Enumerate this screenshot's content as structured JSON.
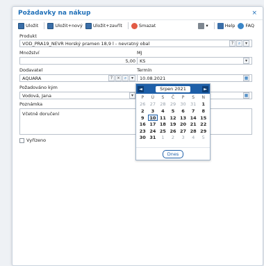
{
  "dialog": {
    "title": "Požadavky na nákup",
    "close_glyph": "×"
  },
  "toolbar": {
    "save": "Uložit",
    "save_new": "Uložit+nový",
    "save_close": "Uložit+zavřít",
    "delete": "Smazat",
    "help": "Help",
    "faq": "FAQ"
  },
  "form": {
    "product_label": "Produkt",
    "product_value": "VOD_PRA19_NEVR Horský pramen 18,9 l - nevratný obal",
    "quantity_label": "Množství",
    "quantity_value": "5,00",
    "unit_label": "MJ",
    "unit_value": "KS",
    "supplier_label": "Dodavatel",
    "supplier_value": "AQUARA",
    "term_label": "Termín",
    "term_value": "10.08.2021",
    "requested_by_label": "Požadováno kým",
    "requested_by_value": "Vodová, Jana",
    "note_label": "Poznámka",
    "note_value": "Včetně doručení",
    "done_label": "Vyřízeno"
  },
  "calendar": {
    "month": "Srpen 2021",
    "prev": "◄",
    "next": "►",
    "weekdays": [
      "P",
      "Ú",
      "S",
      "Č",
      "P",
      "S",
      "N"
    ],
    "days": [
      {
        "d": "26",
        "o": true
      },
      {
        "d": "27",
        "o": true
      },
      {
        "d": "28",
        "o": true
      },
      {
        "d": "29",
        "o": true
      },
      {
        "d": "30",
        "o": true
      },
      {
        "d": "31",
        "o": true
      },
      {
        "d": "1",
        "o": false
      },
      {
        "d": "2",
        "o": false
      },
      {
        "d": "3",
        "o": false
      },
      {
        "d": "4",
        "o": false
      },
      {
        "d": "5",
        "o": false
      },
      {
        "d": "6",
        "o": false
      },
      {
        "d": "7",
        "o": false
      },
      {
        "d": "8",
        "o": false
      },
      {
        "d": "9",
        "o": false
      },
      {
        "d": "10",
        "o": false,
        "sel": true
      },
      {
        "d": "11",
        "o": false
      },
      {
        "d": "12",
        "o": false
      },
      {
        "d": "13",
        "o": false
      },
      {
        "d": "14",
        "o": false
      },
      {
        "d": "15",
        "o": false
      },
      {
        "d": "16",
        "o": false
      },
      {
        "d": "17",
        "o": false
      },
      {
        "d": "18",
        "o": false
      },
      {
        "d": "19",
        "o": false
      },
      {
        "d": "20",
        "o": false
      },
      {
        "d": "21",
        "o": false
      },
      {
        "d": "22",
        "o": false
      },
      {
        "d": "23",
        "o": false
      },
      {
        "d": "24",
        "o": false
      },
      {
        "d": "25",
        "o": false
      },
      {
        "d": "26",
        "o": false
      },
      {
        "d": "27",
        "o": false
      },
      {
        "d": "28",
        "o": false
      },
      {
        "d": "29",
        "o": false
      },
      {
        "d": "30",
        "o": false
      },
      {
        "d": "31",
        "o": false
      },
      {
        "d": "1",
        "o": true
      },
      {
        "d": "2",
        "o": true
      },
      {
        "d": "3",
        "o": true
      },
      {
        "d": "4",
        "o": true
      },
      {
        "d": "5",
        "o": true
      }
    ],
    "today_button": "Dnes"
  },
  "icons": {
    "search": "⌕",
    "dropdown": "▾",
    "clear": "×",
    "calendar": "▦",
    "help": "?"
  },
  "colors": {
    "accent": "#1e6fb8",
    "calendar_header": "#1e5fa8"
  }
}
